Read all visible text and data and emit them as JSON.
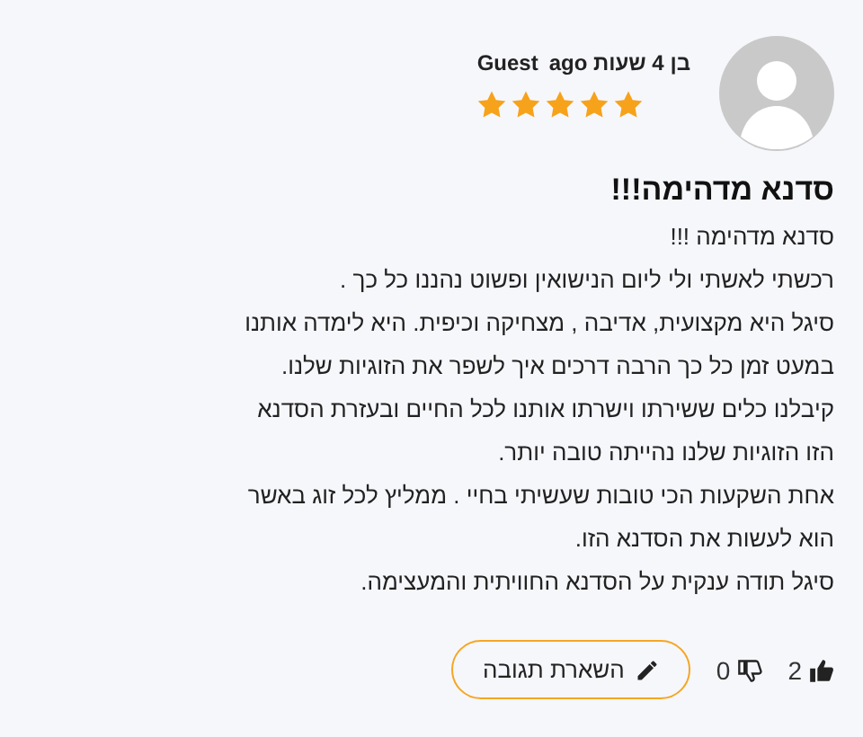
{
  "review": {
    "author": "Guest",
    "time": "בן 4 שעות ago",
    "stars": 5,
    "title": "סדנא מדהימה!!!",
    "paragraphs": [
      "סדנא מדהימה !!!",
      "רכשתי לאשתי ולי ליום הנישואין ופשוט נהננו כל כך .",
      "סיגל היא מקצועית, אדיבה , מצחיקה וכיפית.  היא לימדה אותנו במעט זמן כל כך הרבה דרכים איך לשפר את הזוגיות שלנו. קיבלנו כלים ששירתו וישרתו אותנו לכל החיים ובעזרת הסדנא הזו הזוגיות שלנו נהייתה טובה יותר.",
      "אחת השקעות הכי טובות שעשיתי בחיי . ממליץ לכל זוג באשר הוא לעשות את הסדנא הזו.",
      "סיגל תודה ענקית על הסדנא החוויתית והמעצימה."
    ],
    "likes": "2",
    "dislikes": "0",
    "reply_button": "השארת תגובה"
  }
}
